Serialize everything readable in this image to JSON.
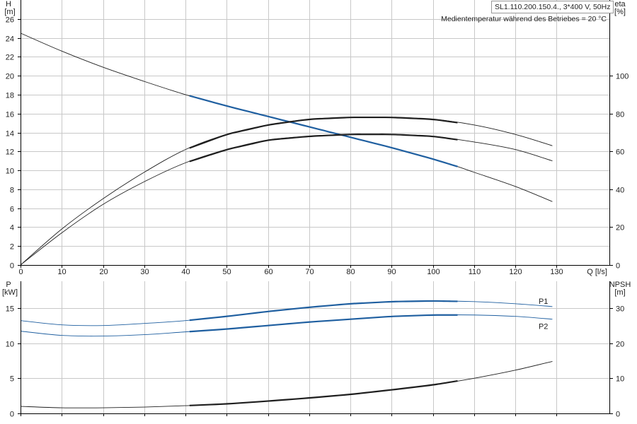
{
  "header": {
    "model": "SL1.110.200.150.4., 3*400 V, 50Hz",
    "note": "Medientemperatur während des Betriebes = 20 °C"
  },
  "colors": {
    "curve": "#1f1f1f",
    "operating": "#1f5fa0",
    "grid": "#c8c8c8"
  },
  "chart_data": [
    {
      "type": "line",
      "name": "head-efficiency",
      "xlabel": "Q [l/s]",
      "xlim": [
        0,
        143
      ],
      "xticks": [
        0,
        10,
        20,
        30,
        40,
        50,
        60,
        70,
        80,
        90,
        100,
        110,
        120,
        130
      ],
      "left_axis": {
        "label": [
          "H",
          "[m]"
        ],
        "ylim": [
          0,
          28
        ],
        "ticks": [
          0,
          2,
          4,
          6,
          8,
          10,
          12,
          14,
          16,
          18,
          20,
          22,
          24,
          26
        ]
      },
      "right_axis": {
        "label": [
          "eta",
          "[%]"
        ],
        "ylim": [
          0,
          140
        ],
        "ticks": [
          0,
          20,
          40,
          60,
          80,
          100
        ]
      },
      "grid": true,
      "series": [
        {
          "id": "H",
          "axis": "left",
          "color": "#1f1f1f",
          "highlight": [
            41,
            106
          ],
          "highlight_color": "#1f5fa0",
          "x": [
            0,
            10,
            20,
            30,
            40,
            50,
            60,
            70,
            80,
            90,
            100,
            106,
            110,
            120,
            129
          ],
          "y": [
            24.5,
            22.6,
            20.9,
            19.4,
            18.0,
            16.8,
            15.7,
            14.6,
            13.5,
            12.4,
            11.2,
            10.4,
            9.8,
            8.3,
            6.7
          ]
        },
        {
          "id": "eta-upper",
          "axis": "right",
          "color": "#1f1f1f",
          "highlight": [
            41,
            106
          ],
          "highlight_color": "#1f1f1f",
          "x": [
            0,
            10,
            20,
            30,
            40,
            50,
            60,
            70,
            80,
            90,
            100,
            110,
            120,
            129
          ],
          "y": [
            0,
            19,
            35,
            49,
            61,
            69,
            74,
            77,
            78,
            78,
            77,
            74,
            69,
            63
          ]
        },
        {
          "id": "eta-lower",
          "axis": "right",
          "color": "#1f1f1f",
          "highlight": [
            41,
            106
          ],
          "highlight_color": "#1f1f1f",
          "x": [
            0,
            10,
            20,
            30,
            40,
            50,
            60,
            70,
            80,
            90,
            100,
            110,
            120,
            129
          ],
          "y": [
            0,
            17,
            32,
            44,
            54,
            61,
            66,
            68,
            69,
            69,
            68,
            65,
            61,
            55
          ]
        }
      ]
    },
    {
      "type": "line",
      "name": "power-npsh",
      "xlim": [
        0,
        143
      ],
      "left_axis": {
        "label": [
          "P",
          "[kW]"
        ],
        "ylim": [
          0,
          18.8
        ],
        "ticks": [
          0,
          5,
          10,
          15
        ]
      },
      "right_axis": {
        "label": [
          "NPSH",
          "[m]"
        ],
        "ylim": [
          0,
          37.6
        ],
        "ticks": [
          0,
          10,
          20,
          30
        ]
      },
      "grid": true,
      "series": [
        {
          "id": "P1",
          "name": "P1",
          "axis": "left",
          "color": "#1f5fa0",
          "highlight": [
            41,
            106
          ],
          "highlight_color": "#1f5fa0",
          "x": [
            0,
            10,
            20,
            30,
            40,
            50,
            60,
            70,
            80,
            90,
            100,
            110,
            120,
            129
          ],
          "y": [
            13.2,
            12.6,
            12.5,
            12.8,
            13.2,
            13.8,
            14.5,
            15.1,
            15.6,
            15.9,
            16.0,
            15.9,
            15.6,
            15.2
          ]
        },
        {
          "id": "P2",
          "name": "P2",
          "axis": "left",
          "color": "#1f5fa0",
          "highlight": [
            41,
            106
          ],
          "highlight_color": "#1f5fa0",
          "x": [
            0,
            10,
            20,
            30,
            40,
            50,
            60,
            70,
            80,
            90,
            100,
            110,
            120,
            129
          ],
          "y": [
            11.7,
            11.1,
            11.0,
            11.2,
            11.6,
            12.0,
            12.5,
            13.0,
            13.4,
            13.8,
            14.0,
            14.0,
            13.8,
            13.4
          ]
        },
        {
          "id": "NPSH",
          "axis": "right",
          "color": "#1f1f1f",
          "highlight": [
            41,
            106
          ],
          "highlight_color": "#1f1f1f",
          "x": [
            0,
            10,
            20,
            30,
            40,
            50,
            60,
            70,
            80,
            90,
            100,
            110,
            120,
            129
          ],
          "y": [
            2.0,
            1.6,
            1.6,
            1.8,
            2.2,
            2.7,
            3.5,
            4.4,
            5.4,
            6.7,
            8.1,
            10.0,
            12.3,
            14.8
          ]
        }
      ]
    }
  ]
}
